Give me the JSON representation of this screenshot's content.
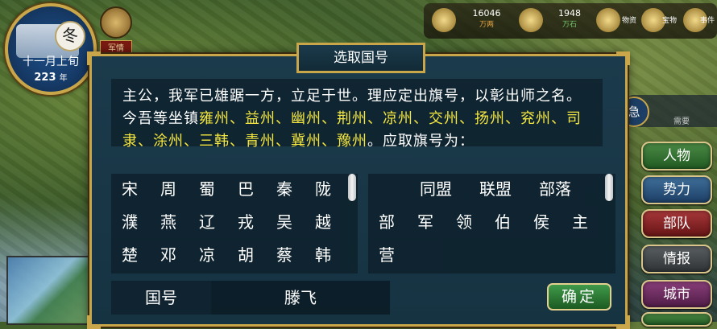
{
  "season": {
    "mark": "冬",
    "date": "十一月上旬",
    "year": "223",
    "year_unit": "年"
  },
  "army_report": {
    "label": "军情"
  },
  "resources": [
    {
      "icon": "gold-icon",
      "value": "16046",
      "sub": "万两"
    },
    {
      "icon": "food-icon",
      "value": "1948",
      "sub": "万石"
    },
    {
      "icon": "affairs-icon",
      "value": "",
      "sub": "物资"
    },
    {
      "icon": "treasure-icon",
      "value": "",
      "sub": "宝物"
    },
    {
      "icon": "events-icon",
      "value": "",
      "sub": "事件"
    }
  ],
  "side_panel": {
    "circle_label": "急",
    "text": "需要"
  },
  "side_menu": [
    {
      "label": "人物",
      "style": "green"
    },
    {
      "label": "势力",
      "style": "blue"
    },
    {
      "label": "部队",
      "style": "red"
    },
    {
      "label": "情报",
      "style": "gray"
    },
    {
      "label": "城市",
      "style": "purple"
    },
    {
      "label": "",
      "style": "green"
    }
  ],
  "dialog": {
    "title": "选取国号",
    "intro_1": "主公，我军已雄踞一方，立足于世。理应定出旗号，以彰出师之名。今吾等坐镇",
    "provinces_1": "雍州、益州、幽州、荆州、凉州、交州、扬州、兖州、司隶、涂州、三韩、青州、冀州、豫州",
    "intro_2": "。应取旗号为：",
    "left_names": [
      "宋",
      "周",
      "蜀",
      "巴",
      "秦",
      "陇",
      "濮",
      "燕",
      "辽",
      "戎",
      "吴",
      "越",
      "楚",
      "邓",
      "凉",
      "胡",
      "蔡",
      "韩"
    ],
    "right_names_row1": [
      "",
      "同盟",
      "联盟",
      "部落"
    ],
    "right_names_row2": [
      "部",
      "军",
      "领",
      "伯",
      "侯",
      "主"
    ],
    "right_names_row3": [
      "营",
      "",
      "",
      "",
      "",
      ""
    ],
    "name_label": "国号",
    "name_value": "滕飞",
    "confirm_label": "确定"
  },
  "colors": {
    "frame": "#c9a64a",
    "panel": "#1b3a4b",
    "highlight": "#f4e640"
  }
}
